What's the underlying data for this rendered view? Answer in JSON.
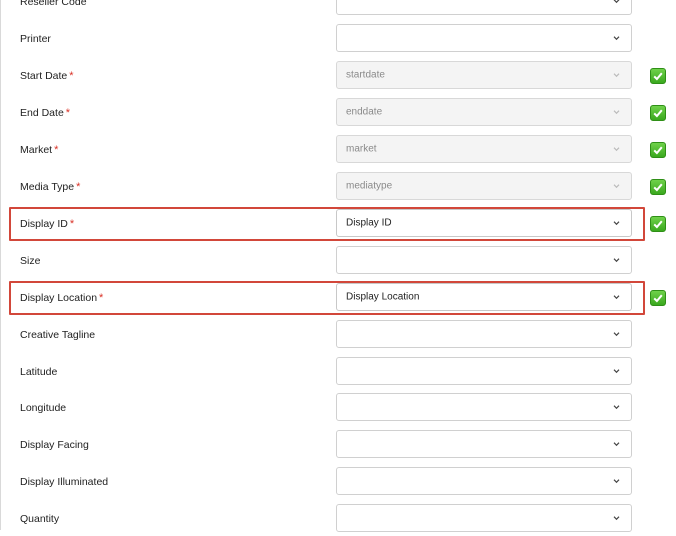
{
  "colors": {
    "highlight_border": "#d2473a",
    "required_asterisk": "#d93025",
    "checkmark_green": "#3aa81e"
  },
  "required_mark": "*",
  "fields": [
    {
      "label": "Reseller Code",
      "required": false,
      "value": "",
      "placeholder": "",
      "disabled": false,
      "checked": false,
      "highlighted": false
    },
    {
      "label": "Printer",
      "required": false,
      "value": "",
      "placeholder": "",
      "disabled": false,
      "checked": false,
      "highlighted": false
    },
    {
      "label": "Start Date",
      "required": true,
      "value": "startdate",
      "placeholder": "",
      "disabled": true,
      "checked": true,
      "highlighted": false
    },
    {
      "label": "End Date",
      "required": true,
      "value": "enddate",
      "placeholder": "",
      "disabled": true,
      "checked": true,
      "highlighted": false
    },
    {
      "label": "Market",
      "required": true,
      "value": "market",
      "placeholder": "",
      "disabled": true,
      "checked": true,
      "highlighted": false
    },
    {
      "label": "Media Type",
      "required": true,
      "value": "mediatype",
      "placeholder": "",
      "disabled": true,
      "checked": true,
      "highlighted": false
    },
    {
      "label": "Display ID",
      "required": true,
      "value": "Display ID",
      "placeholder": "",
      "disabled": false,
      "checked": true,
      "highlighted": true
    },
    {
      "label": "Size",
      "required": false,
      "value": "",
      "placeholder": "",
      "disabled": false,
      "checked": false,
      "highlighted": false
    },
    {
      "label": "Display Location",
      "required": true,
      "value": "Display Location",
      "placeholder": "",
      "disabled": false,
      "checked": true,
      "highlighted": true
    },
    {
      "label": "Creative Tagline",
      "required": false,
      "value": "",
      "placeholder": "",
      "disabled": false,
      "checked": false,
      "highlighted": false
    },
    {
      "label": "Latitude",
      "required": false,
      "value": "",
      "placeholder": "",
      "disabled": false,
      "checked": false,
      "highlighted": false
    },
    {
      "label": "Longitude",
      "required": false,
      "value": "",
      "placeholder": "",
      "disabled": false,
      "checked": false,
      "highlighted": false
    },
    {
      "label": "Display Facing",
      "required": false,
      "value": "",
      "placeholder": "",
      "disabled": false,
      "checked": false,
      "highlighted": false
    },
    {
      "label": "Display Illuminated",
      "required": false,
      "value": "",
      "placeholder": "",
      "disabled": false,
      "checked": false,
      "highlighted": false
    },
    {
      "label": "Quantity",
      "required": false,
      "value": "",
      "placeholder": "",
      "disabled": false,
      "checked": false,
      "highlighted": false
    }
  ]
}
